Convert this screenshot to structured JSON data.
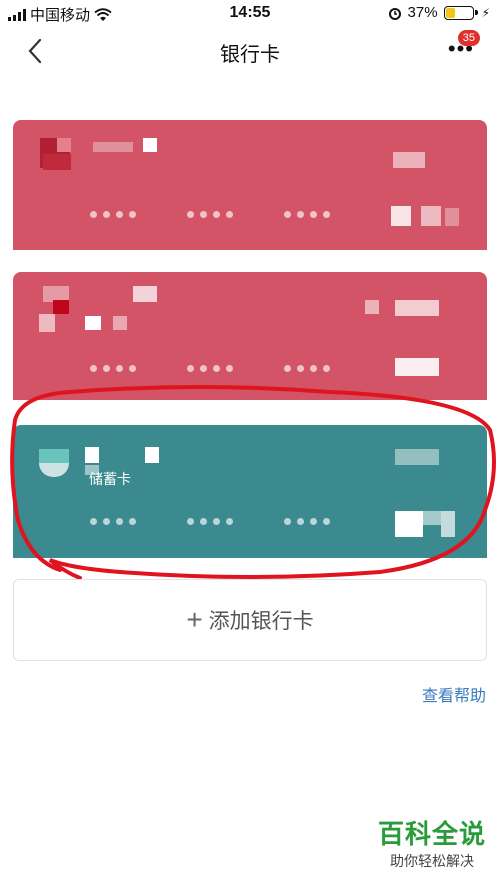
{
  "status_bar": {
    "carrier": "中国移动",
    "time": "14:55",
    "battery_percent": "37%"
  },
  "nav": {
    "title": "银行卡",
    "notification_count": "35"
  },
  "cards": [
    {
      "color": "#d25466",
      "type_label": ""
    },
    {
      "color": "#d25466",
      "type_label": ""
    },
    {
      "color": "#3b8a8f",
      "type_label": "储蓄卡"
    }
  ],
  "add_card": {
    "label": "添加银行卡"
  },
  "help_link": "查看帮助",
  "watermark": {
    "title": "百科全说",
    "subtitle": "助你轻松解决"
  },
  "colors": {
    "annotation": "#e0141e",
    "link": "#3b7bbf",
    "watermark": "#2a9b3a"
  }
}
